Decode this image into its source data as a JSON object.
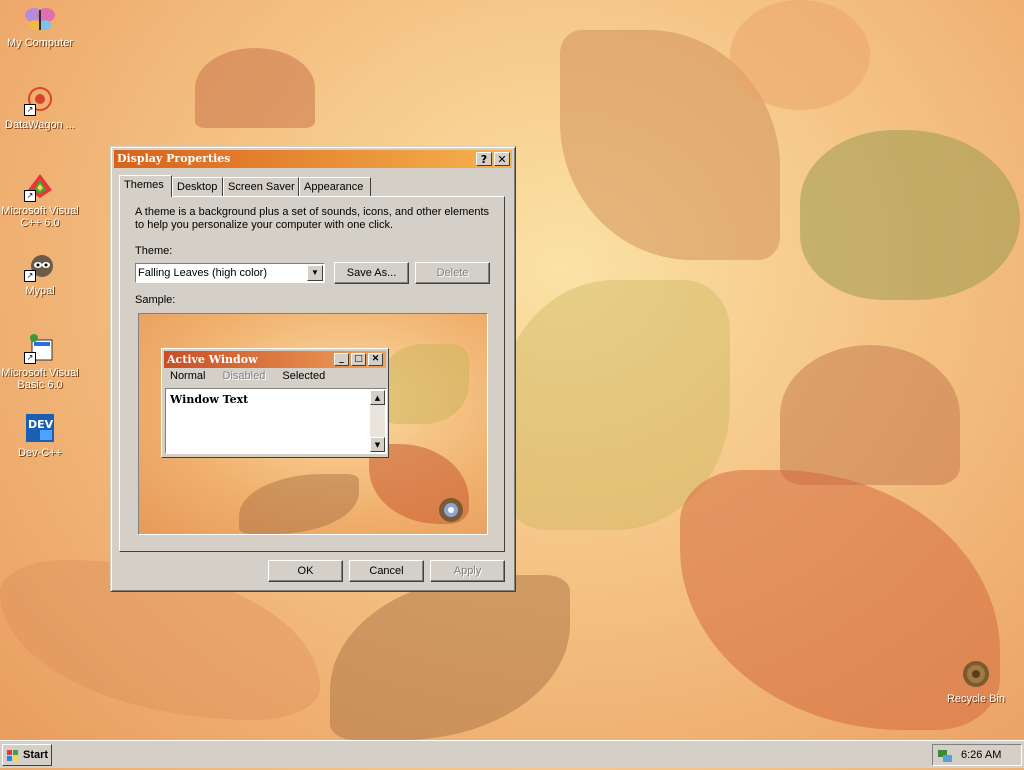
{
  "desktop": {
    "icons": [
      {
        "label": "My Computer",
        "icon": "butterfly-computer-icon"
      },
      {
        "label": "DataWagon ...",
        "icon": "datawagon-icon"
      },
      {
        "label": "Microsoft Visual C++ 6.0",
        "icon": "visual-cpp-icon"
      },
      {
        "label": "Mypal",
        "icon": "raccoon-mypal-icon"
      },
      {
        "label": "Microsoft Visual Basic 6.0",
        "icon": "visual-basic-icon"
      },
      {
        "label": "Dev-C++",
        "icon": "dev-cpp-icon"
      },
      {
        "label": "Recycle Bin",
        "icon": "recycle-bin-icon"
      }
    ]
  },
  "dialog": {
    "title": "Display Properties",
    "help_btn": "?",
    "close_btn": "✕",
    "tabs": [
      "Themes",
      "Desktop",
      "Screen Saver",
      "Appearance"
    ],
    "active_tab": "Themes",
    "description": "A theme is a background plus a set of sounds, icons, and other elements to help you personalize your computer with one click.",
    "theme_label": "Theme:",
    "theme_value": "Falling Leaves (high color)",
    "save_as": "Save As...",
    "delete": "Delete",
    "sample_label": "Sample:",
    "sample": {
      "window_title": "Active Window",
      "menu": [
        "Normal",
        "Disabled",
        "Selected"
      ],
      "text": "Window Text"
    },
    "ok": "OK",
    "cancel": "Cancel",
    "apply": "Apply"
  },
  "taskbar": {
    "start": "Start",
    "clock": "6:26 AM"
  },
  "colors": {
    "title_gradient_start": "#d8621a",
    "title_gradient_end": "#f6b34f",
    "face": "#d4d0c8"
  }
}
